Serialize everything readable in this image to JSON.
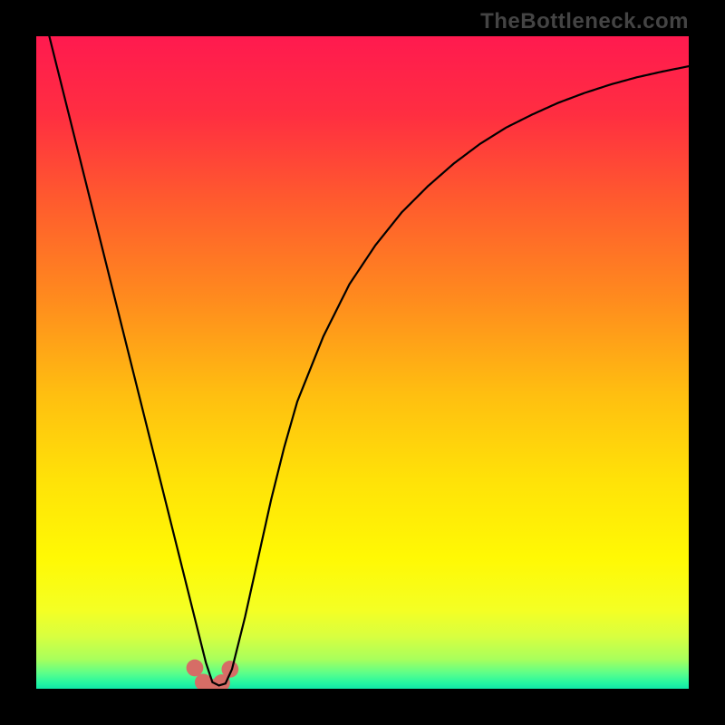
{
  "watermark": "TheBottleneck.com",
  "colors": {
    "frame": "#000000",
    "curve": "#000000",
    "marker": "#d66d66"
  },
  "gradient_stops": [
    {
      "offset": 0.0,
      "color": "#ff1a4f"
    },
    {
      "offset": 0.12,
      "color": "#ff2e41"
    },
    {
      "offset": 0.25,
      "color": "#ff5a2e"
    },
    {
      "offset": 0.4,
      "color": "#ff8a1e"
    },
    {
      "offset": 0.55,
      "color": "#ffbf10"
    },
    {
      "offset": 0.68,
      "color": "#ffe208"
    },
    {
      "offset": 0.8,
      "color": "#fff904"
    },
    {
      "offset": 0.88,
      "color": "#f4ff24"
    },
    {
      "offset": 0.92,
      "color": "#d8ff40"
    },
    {
      "offset": 0.955,
      "color": "#a8ff5c"
    },
    {
      "offset": 0.975,
      "color": "#60ff88"
    },
    {
      "offset": 0.99,
      "color": "#28f7a0"
    },
    {
      "offset": 1.0,
      "color": "#10e8a8"
    }
  ],
  "chart_data": {
    "type": "line",
    "title": "",
    "xlabel": "",
    "ylabel": "",
    "xlim": [
      0,
      100
    ],
    "ylim": [
      0,
      100
    ],
    "x": [
      0,
      2,
      4,
      6,
      8,
      10,
      12,
      14,
      16,
      18,
      20,
      22,
      24,
      25,
      26,
      27,
      28,
      29,
      30,
      32,
      34,
      36,
      38,
      40,
      44,
      48,
      52,
      56,
      60,
      64,
      68,
      72,
      76,
      80,
      84,
      88,
      92,
      96,
      100
    ],
    "y": [
      108,
      100,
      92,
      84,
      76,
      68,
      60,
      52,
      44,
      36,
      28,
      20,
      12,
      8,
      4,
      1,
      0.5,
      0.8,
      3,
      11,
      20,
      29,
      37,
      44,
      54,
      62,
      68,
      73,
      77,
      80.5,
      83.5,
      86,
      88,
      89.8,
      91.3,
      92.6,
      93.7,
      94.6,
      95.4
    ],
    "markers": {
      "x": [
        24.3,
        25.6,
        27.0,
        28.4,
        29.7
      ],
      "y": [
        3.2,
        1.0,
        0.2,
        0.9,
        3.0
      ],
      "r": 1.3
    }
  }
}
